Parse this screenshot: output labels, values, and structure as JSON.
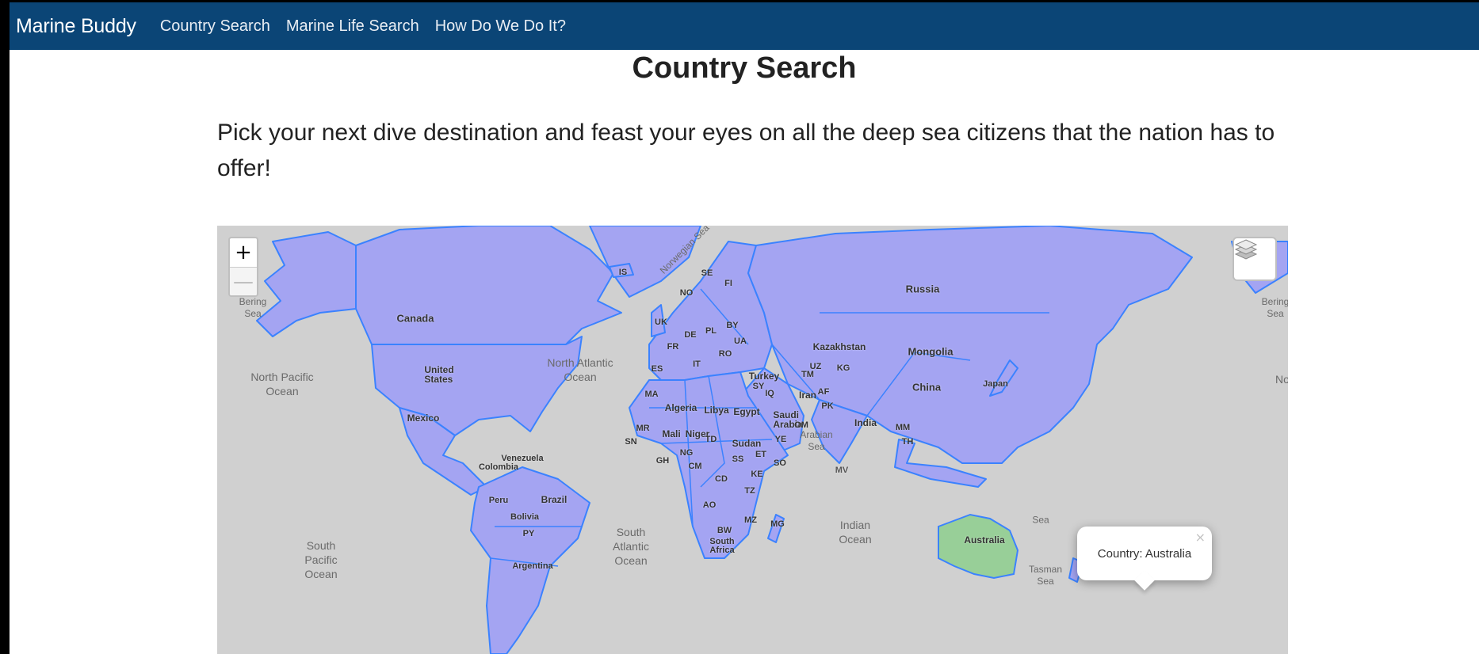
{
  "navbar": {
    "brand": "Marine Buddy",
    "links": [
      "Country Search",
      "Marine Life Search",
      "How Do We Do It?"
    ]
  },
  "page": {
    "title": "Country Search",
    "intro": "Pick your next dive destination and feast your eyes on all the deep sea citizens that the nation has to offer!"
  },
  "map": {
    "zoom_in": "+",
    "zoom_out": "—",
    "popup": {
      "text": "Country: Australia",
      "close": "×"
    },
    "colors": {
      "ocean": "#d0d0d0",
      "land": "#a4a4f2",
      "border": "#3b82ff",
      "selected": "#98cf98"
    },
    "country_labels": [
      "Russia",
      "Canada",
      "United States",
      "Mexico",
      "Kazakhstan",
      "Mongolia",
      "China",
      "India",
      "Iran",
      "Turkey",
      "Algeria",
      "Libya",
      "Egypt",
      "Saudi Arabia",
      "Sudan",
      "Mali",
      "Niger",
      "Brazil",
      "Bolivia",
      "Venezuela",
      "Colombia",
      "Peru",
      "Argentina",
      "Australia",
      "South Africa",
      "Japan",
      "SE",
      "FI",
      "NO",
      "IS",
      "UK",
      "PL",
      "BY",
      "DE",
      "UA",
      "FR",
      "RO",
      "ES",
      "UZ",
      "TM",
      "AF",
      "PK",
      "IQ",
      "SY",
      "MA",
      "MR",
      "TD",
      "NG",
      "ET",
      "SS",
      "KE",
      "CD",
      "TZ",
      "AO",
      "BW",
      "MZ",
      "MG",
      "SO",
      "YE",
      "OM",
      "MV",
      "MM",
      "TH",
      "PY",
      "CM",
      "GH",
      "SN",
      "KG",
      "IT"
    ],
    "ocean_labels": [
      "Bering Sea",
      "Bering Sea",
      "North Pacific Ocean",
      "North Atlantic Ocean",
      "Norwegian Sea",
      "Arabian Sea",
      "Indian Ocean",
      "South Atlantic Ocean",
      "South Pacific Ocean",
      "Tasman Sea",
      "Sea",
      "No"
    ]
  }
}
